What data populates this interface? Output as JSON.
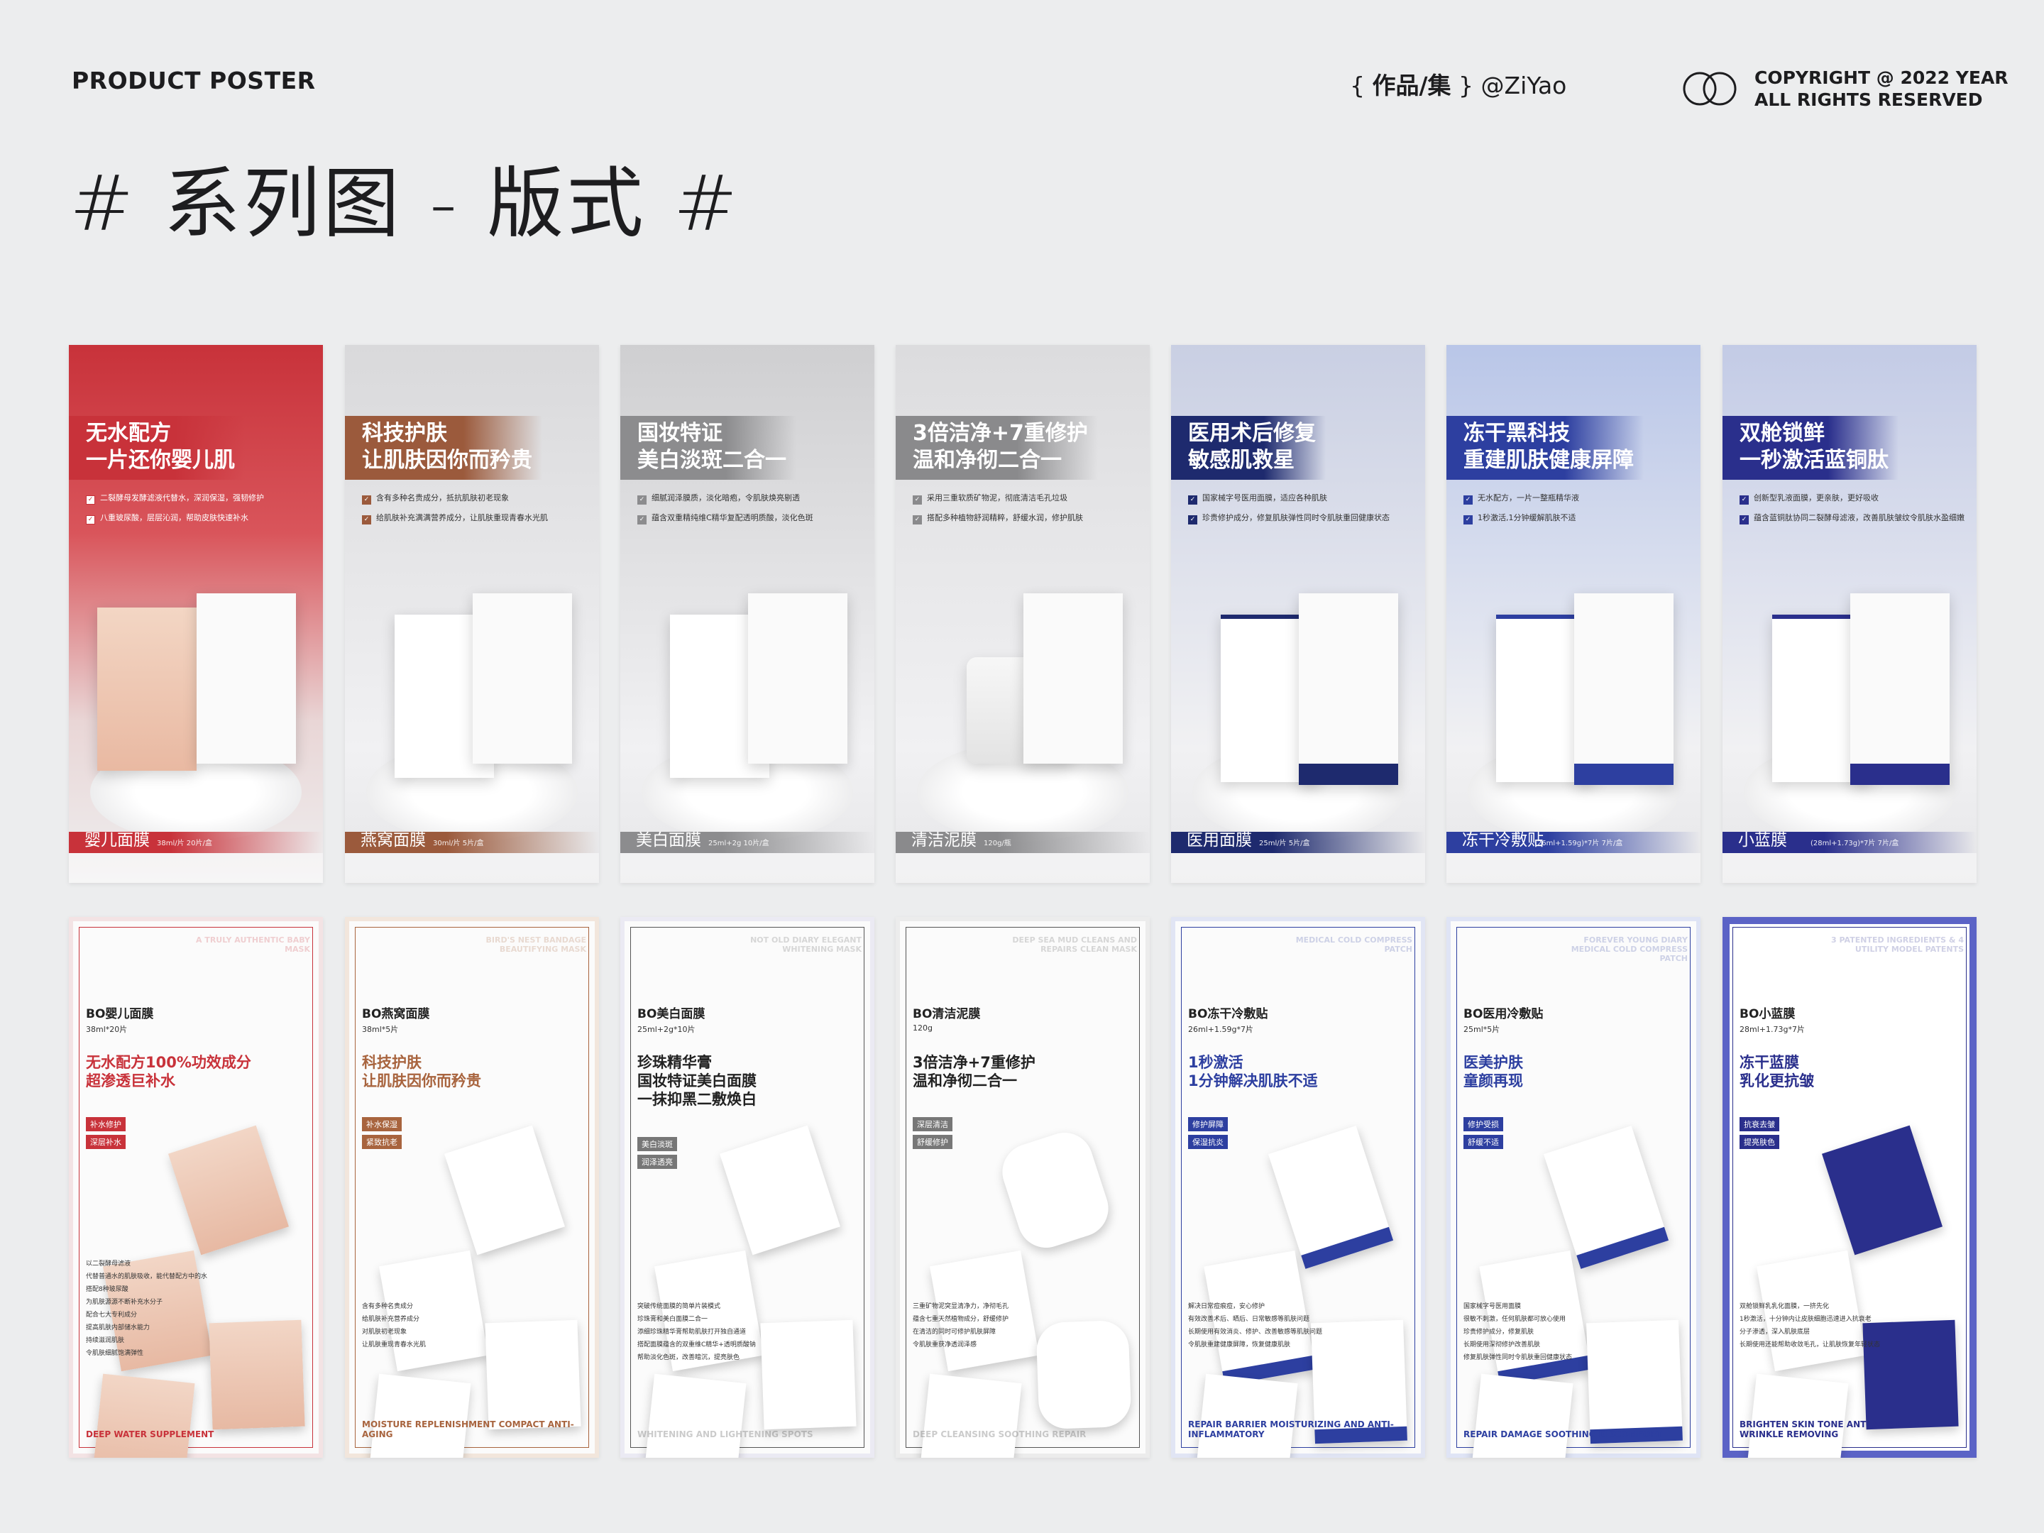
{
  "header": {
    "left_label": "PRODUCT POSTER",
    "center_brace_open": "{ ",
    "center_bold": "作品/集",
    "center_brace_close": " }",
    "center_author": " @ZiYao",
    "copyright_line1": "COPYRIGHT @ 2022 YEAR",
    "copyright_line2": "ALL RIGHTS RESERVED",
    "main_title": "# 系列图 - 版式 #"
  },
  "row1": [
    {
      "headline1": "无水配方",
      "headline2": "一片还你婴儿肌",
      "b1": "二裂酵母发酵滤液代替水，深润保湿，强韧修护",
      "b2": "八重玻尿酸，层层沁润，帮助皮肤快速补水",
      "name": "婴儿面膜",
      "spec": "38ml/片  20片/盒",
      "theme": "#c8323a",
      "bg": "#d14a50"
    },
    {
      "headline1": "科技护肤",
      "headline2": "让肌肤因你而矜贵",
      "b1": "含有多种名贵成分，抵抗肌肤初老现象",
      "b2": "给肌肤补充满满营养成分，让肌肤重现青春水光肌",
      "name": "燕窝面膜",
      "spec": "30ml/片  5片/盒",
      "theme": "#9b5a3c",
      "bg": "#d9d9db"
    },
    {
      "headline1": "国妆特证",
      "headline2": "美白淡斑二合一",
      "b1": "细腻润泽膜质，淡化暗疱，令肌肤焕亮剔透",
      "b2": "蕴含双重精纯维C精华复配透明质酸，淡化色斑",
      "name": "美白面膜",
      "spec": "25ml+2g  10片/盒",
      "theme": "#8c8c8e",
      "bg": "#cfcfd1"
    },
    {
      "headline1": "3倍洁净+7重修护",
      "headline2": "温和净彻二合一",
      "b1": "采用三重软质矿物泥，彻底清洁毛孔垃圾",
      "b2": "搭配多种植物舒润精粹，舒缓水润，修护肌肤",
      "name": "清洁泥膜",
      "spec": "120g/瓶",
      "theme": "#8a8a8c",
      "bg": "#dcdcde"
    },
    {
      "headline1": "医用术后修复",
      "headline2": "敏感肌救星",
      "b1": "国家械字号医用面膜，适应各种肌肤",
      "b2": "珍贵修护成分，修复肌肤弹性同时令肌肤重回健康状态",
      "name": "医用面膜",
      "spec": "25ml/片  5片/盒",
      "theme": "#1e2a6e",
      "bg": "#c9cfe3"
    },
    {
      "headline1": "冻干黑科技",
      "headline2": "重建肌肤健康屏障",
      "b1": "无水配方，一片一整瓶精华液",
      "b2": "1秒激活,1分钟缓解肌肤不适",
      "name": "冻干冷敷贴",
      "spec": "(26ml+1.59g)*7片  7片/盒",
      "theme": "#2d3fa0",
      "bg": "#b9c6e8"
    },
    {
      "headline1": "双舱锁鲜",
      "headline2": "一秒激活蓝铜肽",
      "b1": "创新型乳液面膜，更亲肤，更好吸收",
      "b2": "蕴含蓝铜肽协同二裂酵母滤液，改善肌肤皱纹令肌肤水盈细嫩",
      "name": "小蓝膜",
      "spec": "(28ml+1.73g)*7片  7片/盒",
      "theme": "#2a2f8c",
      "bg": "#c3cbe6"
    }
  ],
  "row2": [
    {
      "name": "BO婴儿面膜",
      "spec": "38ml*20片",
      "h1": "无水配方100%功效成分",
      "h2": "超渗透巨补水",
      "tag1": "补水修护",
      "tag2": "深层补水",
      "bl": [
        "以二裂酵母滤液",
        "代替普通水的肌肤吸收，能代替配方中的水",
        "搭配8种玻尿酸",
        "为肌肤源源不断补充水分子",
        "配合七大专利成分",
        "提高肌肤内部储水能力",
        "持续滋润肌肤",
        "令肌肤细腻饱满弹性"
      ],
      "eng": "DEEP WATER SUPPLEMENT",
      "wm": "A TRULY AUTHENTIC BABY MASK",
      "color": "#c8323a"
    },
    {
      "name": "BO燕窝面膜",
      "spec": "38ml*5片",
      "h1": "科技护肤",
      "h2": "让肌肤因你而矜贵",
      "tag1": "补水保湿",
      "tag2": "紧致抗老",
      "bl": [
        "含有多种名贵成分",
        "给肌肤补充营养成分",
        "对肌肤初老现象",
        "让肌肤重现青春水光肌"
      ],
      "eng": "MOISTURE REPLENISHMENT COMPACT ANTI-AGING",
      "wm": "BIRD'S NEST BANDAGE BEAUTIFYING MASK",
      "color": "#a8643e"
    },
    {
      "name": "BO美白面膜",
      "spec": "25ml+2g*10片",
      "h1": "珍珠精华膏",
      "h2": "国妆特证美白面膜",
      "h3": "一抹抑黑二敷焕白",
      "tag1": "美白淡斑",
      "tag2": "润泽透亮",
      "bl": [
        "突破传统面膜的简单片装模式",
        "珍珠膏和美白面膜二合一",
        "添细珍珠精华膏帮助肌肤打开独自通道",
        "搭配面膜蕴含的双重维C精华+透明质酸钠",
        "帮助淡化色斑，改善暗沉，提亮肤色"
      ],
      "eng": "WHITENING AND LIGHTENING SPOTS",
      "wm": "NOT OLD DIARY ELEGANT WHITENING MASK",
      "color": "#555"
    },
    {
      "name": "BO清洁泥膜",
      "spec": "120g",
      "h1": "3倍洁净+7重修护",
      "h2": "温和净彻二合一",
      "tag1": "深层清洁",
      "tag2": "舒缓修护",
      "bl": [
        "三重矿物泥突显清净力，净彻毛孔",
        "蕴含七重天然植物成分，舒缓修护",
        "在清洁的同时可修护肌肤屏障",
        "令肌肤重获净透润泽感"
      ],
      "eng": "DEEP CLEANSING SOOTHING REPAIR",
      "wm": "DEEP SEA MUD CLEANS AND REPAIRS CLEAN MASK",
      "color": "#555"
    },
    {
      "name": "BO冻干冷敷贴",
      "spec": "26ml+1.59g*7片",
      "h1": "1秒激活",
      "h2": "1分钟解决肌肤不适",
      "tag1": "修护屏障",
      "tag2": "保湿抗炎",
      "bl": [
        "解决日常痘痕痘，安心修护",
        "有效改善术后、晒后、日常敏感等肌肤问题",
        "长期使用有效消炎、修护、改善敏感等肌肤问题",
        "令肌肤重建健康屏障，恢复健康肌肤"
      ],
      "eng": "REPAIR BARRIER MOISTURIZING AND ANTI-INFLAMMATORY",
      "wm": "MEDICAL COLD COMPRESS PATCH",
      "color": "#2d3fa0"
    },
    {
      "name": "BO医用冷敷贴",
      "spec": "25ml*5片",
      "h1": "医美护肤",
      "h2": "童颜再现",
      "tag1": "修护受损",
      "tag2": "舒缓不适",
      "bl": [
        "国家械字号医用面膜",
        "很敏不刺激，任何肌肤都可放心使用",
        "珍贵修护成分，修复肌肤",
        "长期使用深彻修护改善肌肤",
        "修复肌肤弹性同时令肌肤重回健康状态"
      ],
      "eng": "REPAIR DAMAGE SOOTHING DISCOMFORT",
      "wm": "FOREVER YOUNG DIARY MEDICAL COLD COMPRESS PATCH",
      "color": "#2d3fa0"
    },
    {
      "name": "BO小蓝膜",
      "spec": "28ml+1.73g*7片",
      "h1": "冻干蓝膜",
      "h2": "乳化更抗皱",
      "tag1": "抗衰去皱",
      "tag2": "提亮肤色",
      "bl": [
        "双舱锁鲜乳乳化面膜，一挤先化",
        "1秒激活，十分钟内让皮肤细胞迅速进入抗衰老",
        "分子渗透，深入肌肤底层",
        "长期使用还能帮助收敛毛孔，让肌肤恢复年轻状态"
      ],
      "eng": "BRIGHTEN SKIN TONE ANTI AGING AND WRINKLE REMOVING",
      "wm": "3 PATENTED INGREDIENTS & 4 UTILITY MODEL PATENTS",
      "color": "#2a2f8c"
    }
  ]
}
